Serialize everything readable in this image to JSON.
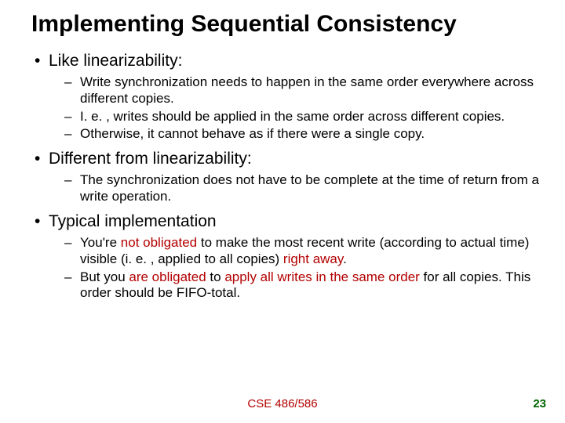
{
  "title": "Implementing Sequential Consistency",
  "b1": "Like linearizability:",
  "b1s1": "Write synchronization needs to happen in the same order everywhere across different copies.",
  "b1s2": "I. e. , writes should be applied in the same order across different copies.",
  "b1s3": "Otherwise, it cannot behave as if there were a single copy.",
  "b2": "Different from linearizability:",
  "b2s1": "The synchronization does not have to be complete at the time of return from a write operation.",
  "b3": "Typical implementation",
  "b3s1a": "You're ",
  "b3s1b": "not obligated",
  "b3s1c": " to make the most recent write (according to actual time) visible (i. e. , applied to all copies) ",
  "b3s1d": "right away",
  "b3s1e": ".",
  "b3s2a": "But you ",
  "b3s2b": "are obligated",
  "b3s2c": " to ",
  "b3s2d": "apply all writes in the same order",
  "b3s2e": " for all copies. This order should be FIFO-total.",
  "footer": "CSE 486/586",
  "pagenum": "23"
}
